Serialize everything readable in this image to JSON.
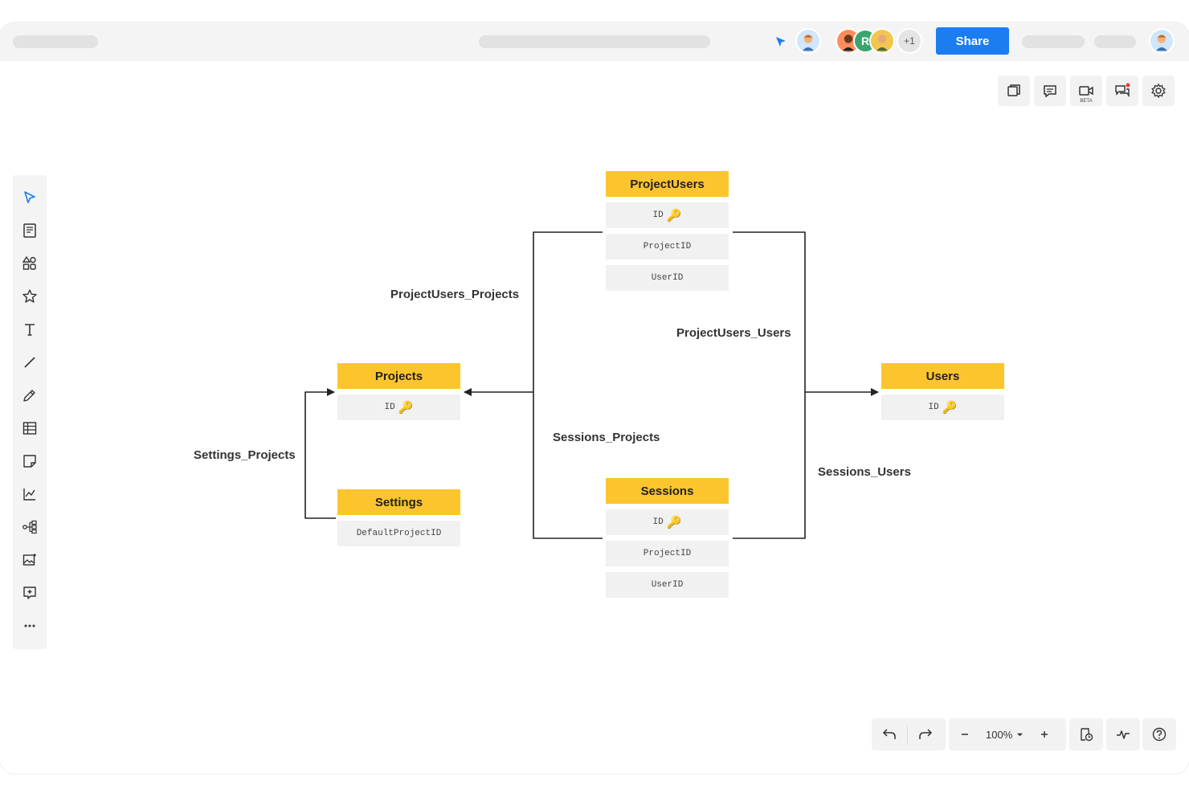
{
  "header": {
    "share_label": "Share",
    "collaborator_initial": "R",
    "extra_collaborators": "+1"
  },
  "top_tools": {
    "video_badge": "BETA"
  },
  "zoom": {
    "level": "100%"
  },
  "entities": {
    "project_users": {
      "title": "ProjectUsers",
      "fields": [
        "ID",
        "ProjectID",
        "UserID"
      ]
    },
    "projects": {
      "title": "Projects",
      "fields": [
        "ID"
      ]
    },
    "users": {
      "title": "Users",
      "fields": [
        "ID"
      ]
    },
    "settings": {
      "title": "Settings",
      "fields": [
        "DefaultProjectID"
      ]
    },
    "sessions": {
      "title": "Sessions",
      "fields": [
        "ID",
        "ProjectID",
        "UserID"
      ]
    }
  },
  "relationships": {
    "project_users_projects": "ProjectUsers_Projects",
    "project_users_users": "ProjectUsers_Users",
    "sessions_projects": "Sessions_Projects",
    "sessions_users": "Sessions_Users",
    "settings_projects": "Settings_Projects"
  },
  "colors": {
    "accent": "#1c7df0",
    "entity_header": "#fdc52d",
    "entity_row": "#f1f1f1",
    "key_icon": "#f0a800"
  },
  "icons": {
    "key": "🔑"
  }
}
